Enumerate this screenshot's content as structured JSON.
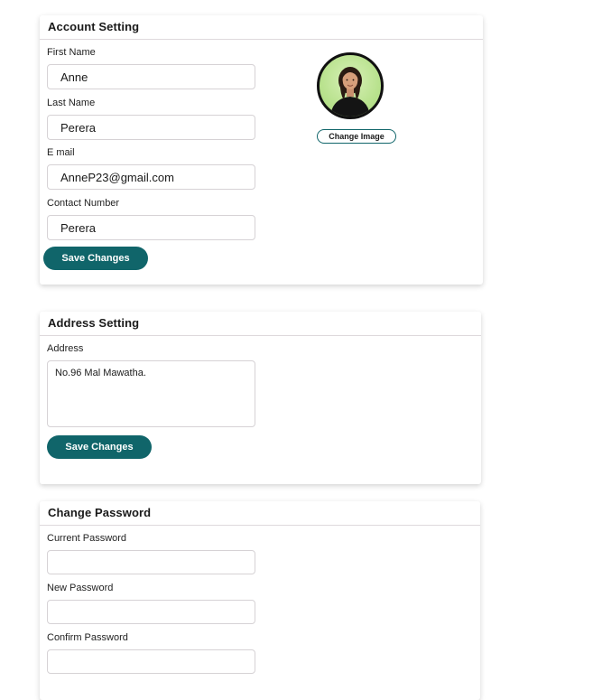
{
  "theme": {
    "accent": "#10656a",
    "border": "#d6d2d5"
  },
  "account": {
    "title": "Account Setting",
    "first_name_label": "First Name",
    "first_name_value": "Anne",
    "last_name_label": "Last Name",
    "last_name_value": "Perera",
    "email_label": "E mail",
    "email_value": "AnneP23@gmail.com",
    "contact_label": "Contact Number",
    "contact_value": "Perera",
    "save_label": "Save Changes",
    "change_image_label": "Change Image"
  },
  "address": {
    "title": "Address Setting",
    "address_label": "Address",
    "address_value": "No.96 Mal Mawatha.",
    "save_label": "Save Changes"
  },
  "password": {
    "title": "Change Password",
    "current_label": "Current Password",
    "current_value": "",
    "new_label": "New Password",
    "new_value": "",
    "confirm_label": "Confirm Password",
    "confirm_value": ""
  }
}
